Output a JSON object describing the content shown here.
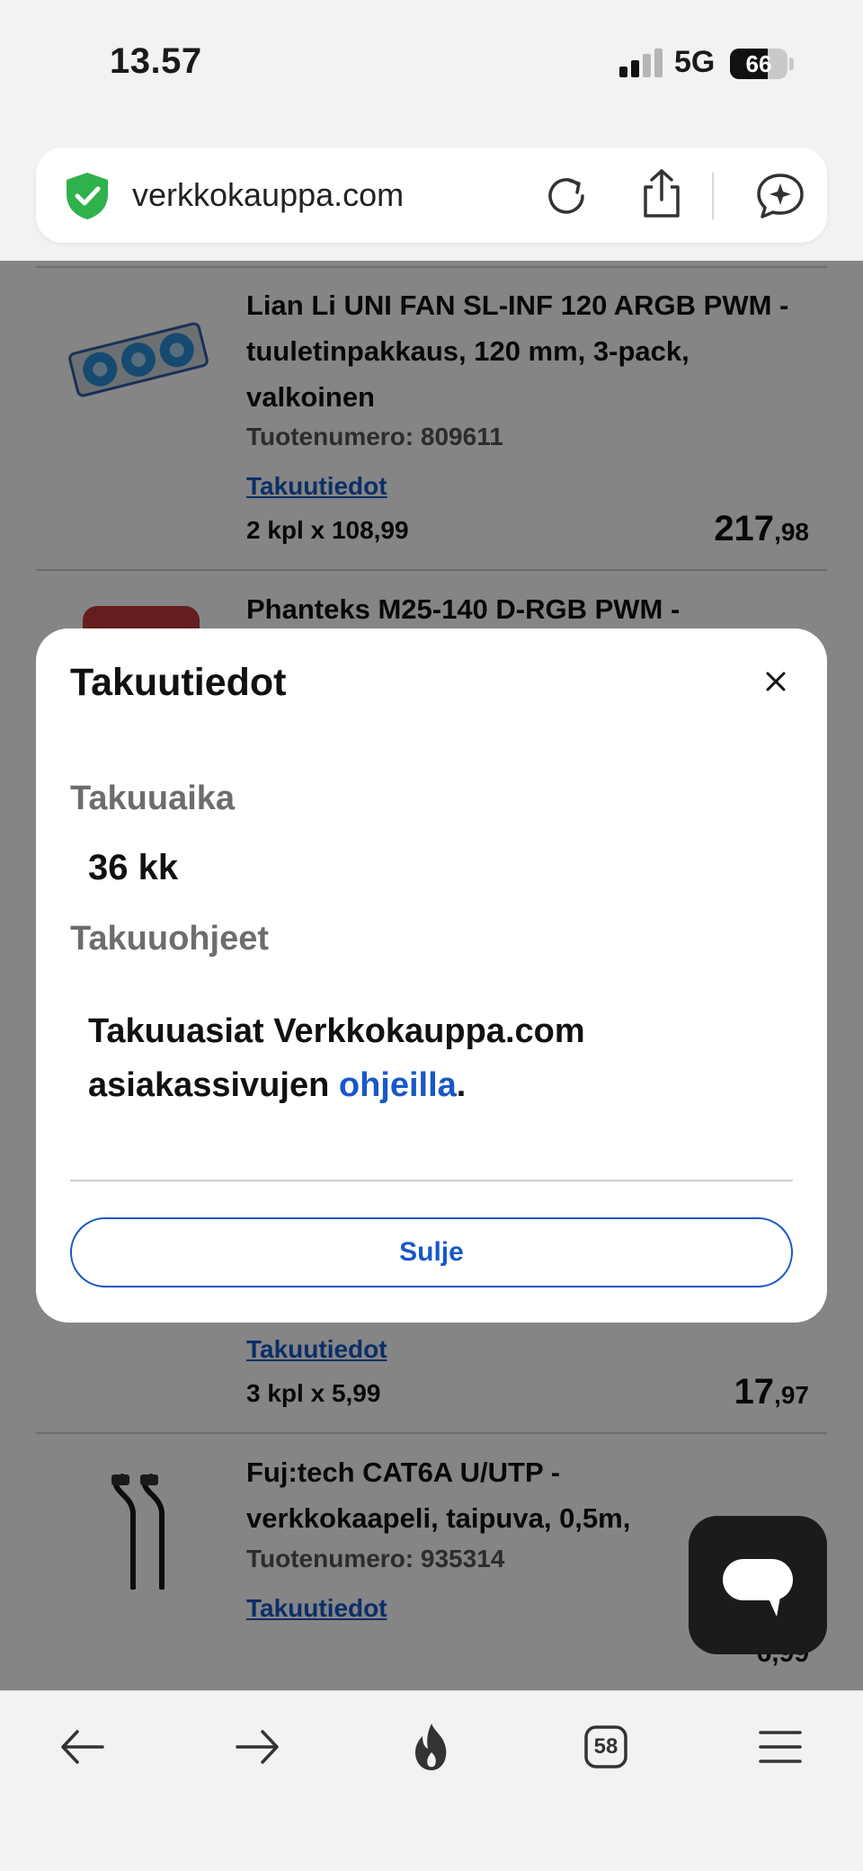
{
  "status_bar": {
    "time": "13.57",
    "network": "5G",
    "battery_percent": "66",
    "signal_bars_active": 2,
    "signal_bars_total": 4
  },
  "address_bar": {
    "url": "verkkokauppa.com",
    "icons": [
      "shield-check-icon",
      "reload-icon",
      "share-icon",
      "assistant-icon"
    ]
  },
  "cart": {
    "items": [
      {
        "name": "Lian Li UNI FAN SL-INF 120 ARGB PWM -tuuletinpakkaus, 120 mm, 3-pack, valkoinen",
        "sku_label": "Tuotenumero: 809611",
        "warranty_link": "Takuutiedot",
        "quantity_line": "2 kpl x 108,99",
        "price_int": "217",
        "price_dec": ",98"
      },
      {
        "name": "Phanteks M25-140 D-RGB PWM -"
      },
      {
        "warranty_link": "Takuutiedot",
        "quantity_line": "3 kpl x 5,99",
        "price_int": "17",
        "price_dec": ",97"
      },
      {
        "name": "Fuj:tech CAT6A U/UTP - verkkokaapeli, taipuva, 0,5m, ",
        "sku_label": "Tuotenumero: 935314",
        "warranty_link": "Takuutiedot",
        "price_partial": "6,99"
      }
    ]
  },
  "modal": {
    "title": "Takuutiedot",
    "period_label": "Takuuaika",
    "period_value": "36 kk",
    "instructions_label": "Takuuohjeet",
    "instructions_text": "Takuuasiat Verkkokauppa.com asiakassivujen ",
    "instructions_link": "ohjeilla",
    "instructions_end": ".",
    "close_label": "Sulje"
  },
  "toolbar": {
    "tabs_count": "58",
    "icons": [
      "back-arrow-icon",
      "forward-arrow-icon",
      "flame-icon",
      "tabs-icon",
      "menu-icon"
    ]
  },
  "colors": {
    "link_blue": "#1858c8",
    "shield_green": "#2fb24c",
    "backdrop": "rgba(0,0,0,0.48)"
  }
}
